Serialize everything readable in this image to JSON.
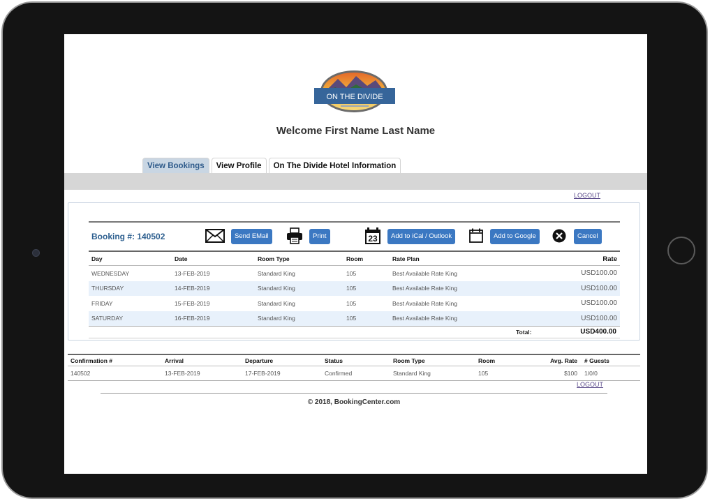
{
  "brand": {
    "logo_text": "ON THE DIVIDE",
    "accent": "#2d5f8f",
    "button_color": "#3b78c2"
  },
  "welcome": "Welcome First Name Last Name",
  "tabs": [
    {
      "label": "View Bookings",
      "active": true
    },
    {
      "label": "View Profile",
      "active": false
    },
    {
      "label": "On The Divide Hotel Information",
      "active": false
    }
  ],
  "logout_label": "LOGOUT",
  "booking": {
    "number_label": "Booking #: 140502",
    "actions": {
      "email": {
        "label": "Send EMail",
        "icon": "envelope-icon"
      },
      "print": {
        "label": "Print",
        "icon": "printer-icon"
      },
      "ical": {
        "label": "Add to iCal / Outlook",
        "icon": "calendar-23-icon",
        "icon_text": "23"
      },
      "google": {
        "label": "Add to Google",
        "icon": "calendar-icon"
      },
      "cancel": {
        "label": "Cancel",
        "icon": "close-circle-icon"
      }
    },
    "columns": {
      "day": "Day",
      "date": "Date",
      "room_type": "Room Type",
      "room": "Room",
      "rate_plan": "Rate Plan",
      "rate": "Rate"
    },
    "rows": [
      {
        "day": "WEDNESDAY",
        "date": "13-FEB-2019",
        "room_type": "Standard King",
        "room": "105",
        "rate_plan": "Best Available Rate King",
        "rate": "USD100.00"
      },
      {
        "day": "THURSDAY",
        "date": "14-FEB-2019",
        "room_type": "Standard King",
        "room": "105",
        "rate_plan": "Best Available Rate King",
        "rate": "USD100.00"
      },
      {
        "day": "FRIDAY",
        "date": "15-FEB-2019",
        "room_type": "Standard King",
        "room": "105",
        "rate_plan": "Best Available Rate King",
        "rate": "USD100.00"
      },
      {
        "day": "SATURDAY",
        "date": "16-FEB-2019",
        "room_type": "Standard King",
        "room": "105",
        "rate_plan": "Best Available Rate King",
        "rate": "USD100.00"
      }
    ],
    "total_label": "Total:",
    "total_value": "USD400.00"
  },
  "summary": {
    "columns": {
      "conf": "Confirmation #",
      "arrival": "Arrival",
      "departure": "Departure",
      "status": "Status",
      "room_type": "Room Type",
      "room": "Room",
      "avg_rate": "Avg. Rate",
      "guests": "# Guests"
    },
    "row": {
      "conf": "140502",
      "arrival": "13-FEB-2019",
      "departure": "17-FEB-2019",
      "status": "Confirmed",
      "room_type": "Standard King",
      "room": "105",
      "avg_rate": "$100",
      "guests": "1/0/0"
    }
  },
  "footer": {
    "copyright": "© 2018, BookingCenter.com"
  }
}
